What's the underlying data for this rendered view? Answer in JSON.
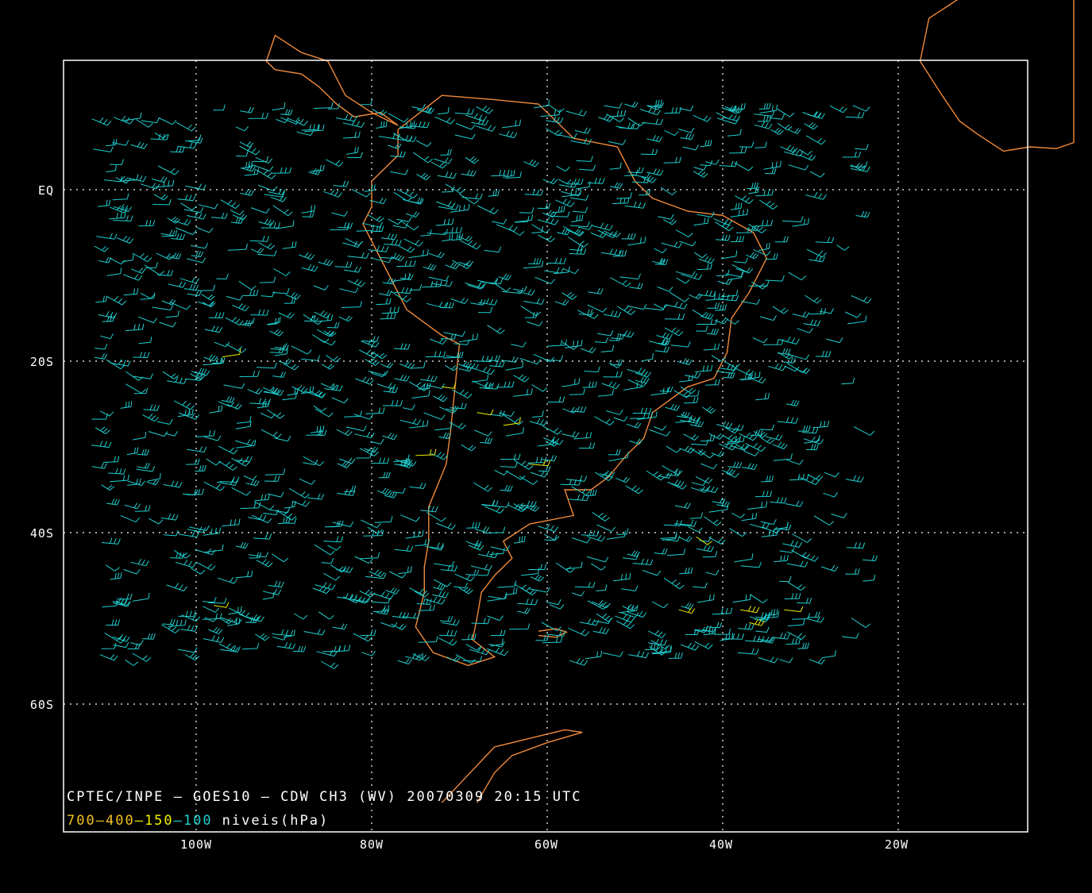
{
  "map": {
    "title": "CPTEC/INPE — GOES10 — CDW CH3 (WV) 20070309 20:15 UTC",
    "legend": {
      "levels": [
        {
          "label": "700",
          "color": "#f0c020"
        },
        {
          "label": "400",
          "color": "#f0c020"
        },
        {
          "label": "150",
          "color": "#f0f000"
        },
        {
          "label": "100",
          "color": "#20d0d0"
        }
      ],
      "separator": "—",
      "suffix": "niveis(hPa)"
    },
    "lat_labels": [
      "EQ",
      "20S",
      "40S",
      "60S"
    ],
    "lon_labels": [
      "100W",
      "80W",
      "60W",
      "40W",
      "20W"
    ],
    "colors": {
      "background": "#000000",
      "frame": "#ffffff",
      "grid": "#ffffff",
      "coastline": "#f08a3c",
      "wind_upper": "#20d0d0",
      "wind_mid": "#f0f000",
      "wind_low": "#f0c020"
    }
  }
}
